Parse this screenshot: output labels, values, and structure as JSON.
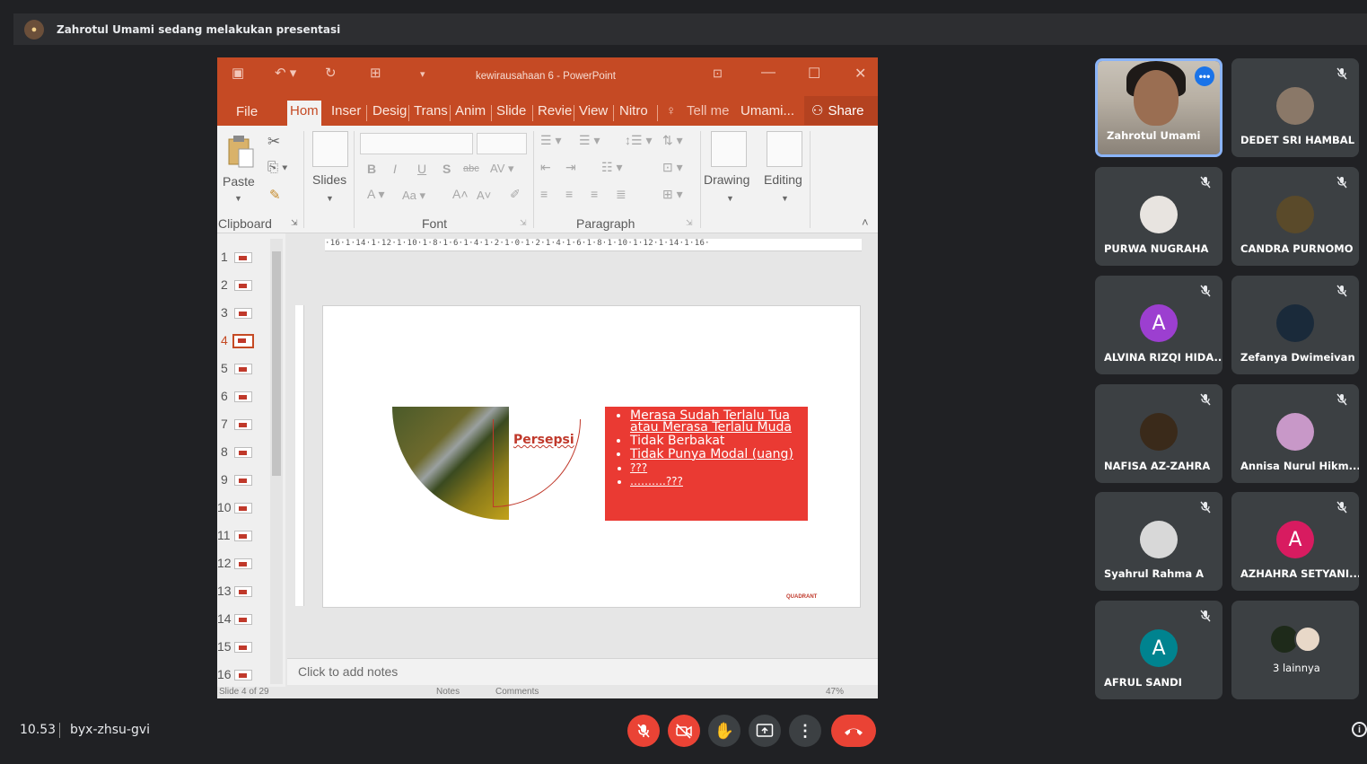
{
  "banner": {
    "text": "Zahrotul Umami sedang melakukan presentasi"
  },
  "powerpoint": {
    "window_title": "kewirausahaan 6 - PowerPoint",
    "tabs": [
      "File",
      "Hom",
      "Inser",
      "Desig",
      "Trans",
      "Anim",
      "Slide",
      "Revie",
      "View",
      "Nitro",
      "Tell me",
      "Umami...",
      "Share"
    ],
    "active_tab": "Hom",
    "ribbon": {
      "paste": "Paste",
      "slides": "Slides",
      "drawing": "Drawing",
      "editing": "Editing",
      "groups": [
        "Clipboard",
        "Font",
        "Paragraph"
      ]
    },
    "thumbnails": [
      "1",
      "2",
      "3",
      "4",
      "5",
      "6",
      "7",
      "8",
      "9",
      "10",
      "11",
      "12",
      "13",
      "14",
      "15",
      "16"
    ],
    "current_slide_index": 4,
    "ruler": "·16·1·14·1·12·1·10·1·8·1·6·1·4·1·2·1·0·1·2·1·4·1·6·1·8·1·10·1·12·1·14·1·16·",
    "slide": {
      "circle_label": "Persepsi",
      "bullets": [
        "Merasa Sudah Terlalu Tua atau Merasa Terlalu Muda",
        "Tidak Berbakat",
        "Tidak Punya Modal (uang)",
        "???",
        "……….???"
      ],
      "footer_logo": "QUADRANT"
    },
    "notes_placeholder": "Click to add notes",
    "status": {
      "slide_of": "Slide 4 of 29",
      "notes": "Notes",
      "comments": "Comments",
      "zoom": "47%"
    }
  },
  "participants": [
    {
      "name": "Zahrotul Umami",
      "type": "video",
      "active": true
    },
    {
      "name": "DEDET SRI HAMBAL",
      "type": "photo",
      "color": "#8a7868",
      "muted": true
    },
    {
      "name": "PURWA NUGRAHA",
      "type": "photo",
      "color": "#e8e4e0",
      "muted": true
    },
    {
      "name": "CANDRA PURNOMO",
      "type": "photo",
      "color": "#5a4a2a",
      "muted": true
    },
    {
      "name": "ALVINA RIZQI HIDA...",
      "type": "initial",
      "initial": "A",
      "color": "#9c3fd0",
      "muted": true
    },
    {
      "name": "Zefanya Dwimeivan",
      "type": "photo",
      "color": "#1a2a3a",
      "muted": true
    },
    {
      "name": "NAFISA AZ-ZAHRA",
      "type": "photo",
      "color": "#3a2a1a",
      "muted": true
    },
    {
      "name": "Annisa Nurul Hikm...",
      "type": "photo",
      "color": "#c898c8",
      "muted": true
    },
    {
      "name": "Syahrul Rahma A",
      "type": "photo",
      "color": "#d8d8d8",
      "muted": true
    },
    {
      "name": "AZHAHRA SETYANI...",
      "type": "initial",
      "initial": "A",
      "color": "#d81b60",
      "muted": true
    },
    {
      "name": "AFRUL SANDI",
      "type": "initial",
      "initial": "A",
      "color": "#00838f",
      "muted": true
    },
    {
      "name": "3 lainnya",
      "type": "others"
    }
  ],
  "bottom": {
    "time": "10.53",
    "meeting_code": "byx-zhsu-gvi",
    "controls": [
      "mic-off",
      "camera-off",
      "raise-hand",
      "present",
      "more",
      "leave"
    ]
  }
}
